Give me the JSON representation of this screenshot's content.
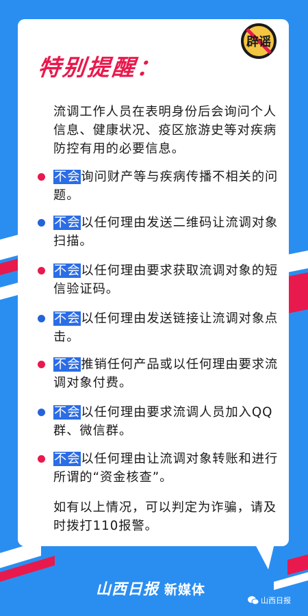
{
  "badge": {
    "text": "辟谣",
    "icon": "no-rumor-icon",
    "color": "#e8194d"
  },
  "title": "特别提醒：",
  "intro": "流调工作人员在表明身份后会询问个人信息、健康状况、疫区旅游史等对疾病防控有用的必要信息。",
  "highlight": "不会",
  "items": [
    {
      "dot": "red",
      "text": "询问财产等与疾病传播不相关的问题。"
    },
    {
      "dot": "blue",
      "text": "以任何理由发送二维码让流调对象扫描。"
    },
    {
      "dot": "red",
      "text": "以任何理由要求获取流调对象的短信验证码。"
    },
    {
      "dot": "blue",
      "text": "以任何理由发送链接让流调对象点击。"
    },
    {
      "dot": "red",
      "text": "推销任何产品或以任何理由要求流调对象付费。"
    },
    {
      "dot": "blue",
      "text": "以任何理由要求流调人员加入QQ群、微信群。"
    },
    {
      "dot": "red",
      "text": "以任何理由让流调对象转账和进行所谓的“资金核查”。"
    }
  ],
  "outro": "如有以上情况，可以判定为诈骗，请及时拨打110报警。",
  "footer": {
    "brand": "山西日报",
    "suffix": "新媒体"
  },
  "watermark": {
    "text": "山西日报",
    "icon": "wechat-icon"
  },
  "colors": {
    "background": "#2a8ef0",
    "accent_red": "#e8194d",
    "highlight_blue": "#2a6de6"
  }
}
